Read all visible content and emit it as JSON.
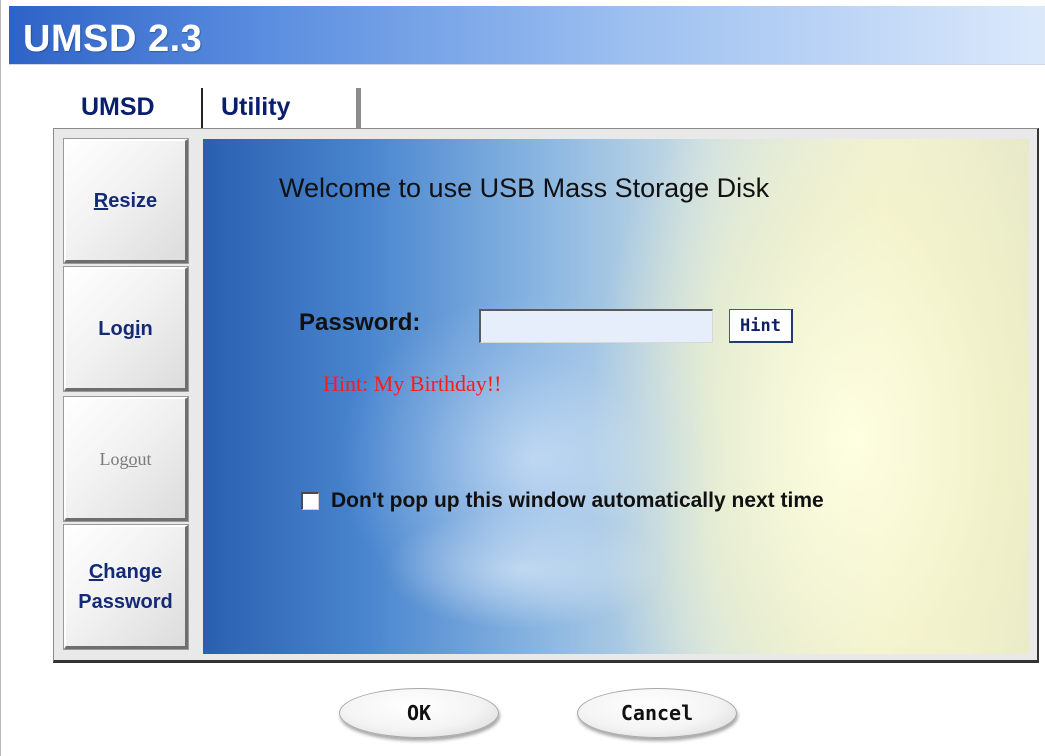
{
  "window": {
    "title": "UMSD 2.3"
  },
  "tabs": [
    {
      "label": "UMSD"
    },
    {
      "label": "Utility"
    }
  ],
  "sidebar": {
    "resize": {
      "mnemonic": "R",
      "rest": "esize"
    },
    "login": {
      "before": "Log",
      "mnemonic": "i",
      "after": "n"
    },
    "logout": {
      "before": "Log",
      "mnemonic": "o",
      "after": "ut"
    },
    "change_password": {
      "mnemonic": "C",
      "rest": "hange",
      "line2": "Password"
    }
  },
  "main": {
    "welcome_text": "Welcome to use USB Mass Storage Disk",
    "password_label": "Password:",
    "password_value": "",
    "hint_button_label": "Hint",
    "hint_text": "Hint: My Birthday!!",
    "checkbox_label": "Don't pop up this window automatically next time",
    "checkbox_checked": false
  },
  "footer": {
    "ok_label": "OK",
    "cancel_label": "Cancel"
  },
  "colors": {
    "title_bar": "#2e63c7",
    "hint_text": "#ff1a1a",
    "label_blue": "#142a74"
  }
}
